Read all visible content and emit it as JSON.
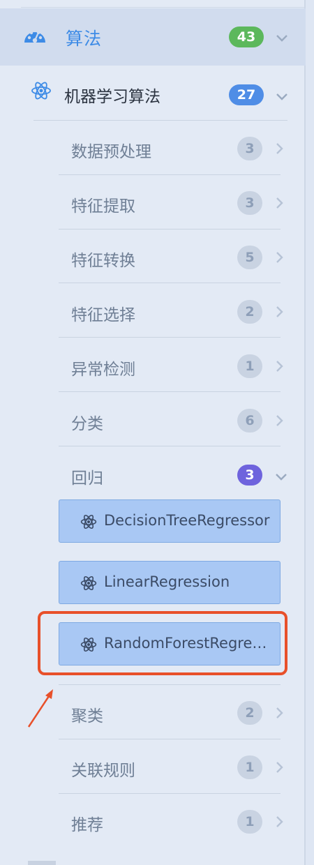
{
  "category": {
    "label": "算法",
    "count": "43",
    "icon": "dashboard-icon"
  },
  "subcategory": {
    "label": "机器学习算法",
    "count": "27",
    "icon": "atom-icon"
  },
  "items": [
    {
      "label": "数据预处理",
      "count": "3"
    },
    {
      "label": "特征提取",
      "count": "3"
    },
    {
      "label": "特征转换",
      "count": "5"
    },
    {
      "label": "特征选择",
      "count": "2"
    },
    {
      "label": "异常检测",
      "count": "1"
    },
    {
      "label": "分类",
      "count": "6"
    }
  ],
  "expanded_item": {
    "label": "回归",
    "count": "3"
  },
  "regression_leaves": [
    {
      "label": "DecisionTreeRegressor"
    },
    {
      "label": "LinearRegression"
    },
    {
      "label": "RandomForestRegressor"
    }
  ],
  "items_after": [
    {
      "label": "聚类",
      "count": "2"
    },
    {
      "label": "关联规则",
      "count": "1"
    },
    {
      "label": "推荐",
      "count": "1"
    }
  ],
  "colors": {
    "accent": "#3d8be6",
    "badge_green": "#5cb85c",
    "badge_blue": "#4f8de6",
    "badge_purple": "#6e63dd",
    "highlight": "#e8502a"
  }
}
